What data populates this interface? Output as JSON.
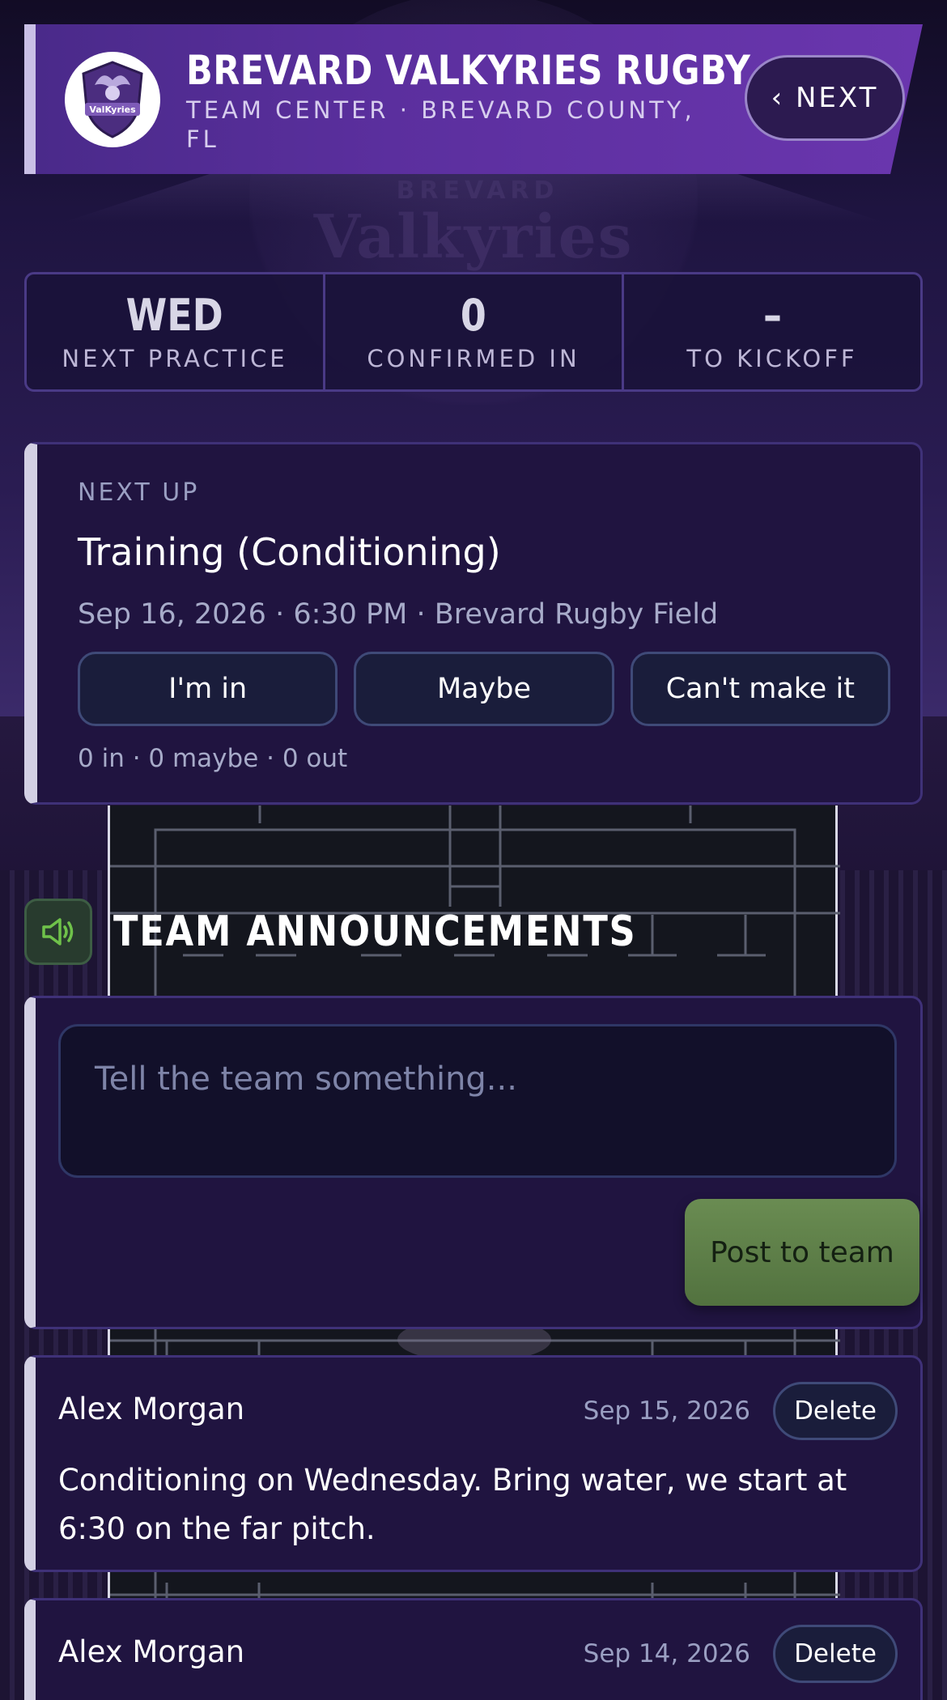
{
  "header": {
    "title": "BREVARD VALKYRIES RUGBY",
    "subtitle": "TEAM CENTER · BREVARD COUNTY, FL",
    "next_button": "‹ NEXT",
    "logo_icon": "valkyries-logo"
  },
  "stats": [
    {
      "value": "WED",
      "label": "NEXT PRACTICE"
    },
    {
      "value": "0",
      "label": "CONFIRMED IN"
    },
    {
      "value": "–",
      "label": "TO KICKOFF"
    }
  ],
  "next_up": {
    "label": "NEXT UP",
    "title": "Training (Conditioning)",
    "meta": "Sep 16, 2026 · 6:30 PM · Brevard Rugby Field",
    "rsvp_in": "I'm in",
    "rsvp_maybe": "Maybe",
    "rsvp_out": "Can't make it",
    "counts": "0 in · 0 maybe · 0 out"
  },
  "announcements": {
    "title": "TEAM ANNOUNCEMENTS",
    "icon": "megaphone-icon",
    "composer_placeholder": "Tell the team something...",
    "post_button": "Post to team",
    "posts": [
      {
        "author": "Alex Morgan",
        "date": "Sep 15, 2026",
        "delete": "Delete",
        "body": "Conditioning on Wednesday. Bring water, we start at 6:30 on the far pitch."
      },
      {
        "author": "Alex Morgan",
        "date": "Sep 14, 2026",
        "delete": "Delete",
        "body": ""
      }
    ]
  },
  "colors": {
    "accent_purple": "#5b2f9e",
    "card_bg": "#201440",
    "post_green": "#6a8c52",
    "icon_green": "#6fc24a"
  }
}
